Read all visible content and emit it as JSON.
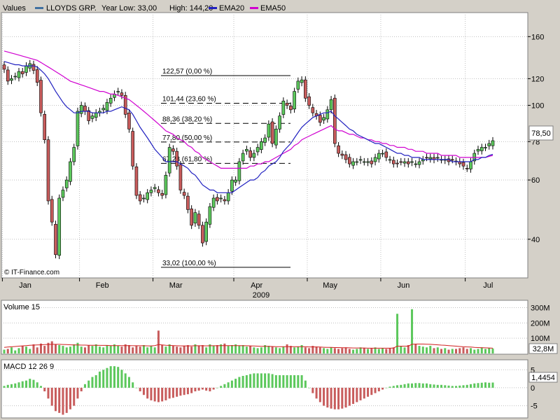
{
  "header": {
    "values_label": "Values",
    "symbol": "LLOYDS GRP.",
    "year_low_label": "Year Low: 33,00",
    "year_high_label": "High: 144,20",
    "ema20_label": "EMA20",
    "ema50_label": "EMA50"
  },
  "colors": {
    "background": "#d4d0c8",
    "plot_bg": "#ffffff",
    "grid": "#c0c0c0",
    "up": "#5cc85c",
    "down": "#c85c5c",
    "ema20": "#2020c0",
    "ema50": "#d000d0",
    "volume_ma": "#d02020",
    "symbol_swatch": "#4070a0"
  },
  "watermark": "© IT-Finance.com",
  "chart_data": [
    {
      "type": "candlestick",
      "title": "LLOYDS GRP.",
      "y_scale": "log",
      "ylim": [
        31,
        185
      ],
      "y_ticks": [
        "40",
        "60",
        "78",
        "100",
        "120",
        "160"
      ],
      "x_months": [
        "Jan",
        "Feb",
        "Mar",
        "Apr",
        "May",
        "Jun",
        "Jul"
      ],
      "x_year_label": "2009",
      "last_value_label": "78,50",
      "fib_levels": [
        {
          "label": "122,57 (0,00 %)",
          "value": 122.57
        },
        {
          "label": "101,44 (23,60 %)",
          "value": 101.44
        },
        {
          "label": "88,36 (38,20 %)",
          "value": 88.36
        },
        {
          "label": "77,80 (50,00 %)",
          "value": 77.8
        },
        {
          "label": "67,23 (61,80 %)",
          "value": 67.23
        },
        {
          "label": "33,02 (100,00 %)",
          "value": 33.02
        }
      ],
      "close": [
        128,
        118,
        120,
        122,
        126,
        124,
        131,
        133,
        127,
        117,
        95,
        79,
        52,
        45,
        36,
        53,
        56,
        60,
        68,
        75,
        96,
        100,
        96,
        90,
        93,
        95,
        96,
        98,
        102,
        105,
        108,
        110,
        107,
        94,
        85,
        66,
        54,
        52,
        53,
        55,
        56,
        57,
        55,
        54,
        62,
        75,
        73,
        66,
        56,
        54,
        49,
        44,
        48,
        44,
        39,
        45,
        50,
        53,
        52,
        53,
        52,
        55,
        60,
        60,
        68,
        72,
        74,
        70,
        72,
        75,
        78,
        80,
        88,
        77,
        85,
        93,
        103,
        100,
        97,
        110,
        118,
        119,
        105,
        100,
        95,
        93,
        89,
        92,
        97,
        104,
        77,
        72,
        71,
        69,
        67,
        68,
        68,
        69,
        68,
        68,
        67,
        70,
        72,
        72,
        70,
        69,
        67,
        67,
        68,
        68,
        67,
        68,
        67,
        68,
        69,
        70,
        70,
        69,
        70,
        69,
        69,
        68,
        69,
        68,
        67,
        66,
        65,
        68,
        72,
        74,
        75,
        75,
        77,
        78.5
      ],
      "series": [
        {
          "name": "EMA20",
          "values": [
            135,
            134,
            133,
            132,
            132,
            131,
            131,
            131,
            131,
            130,
            127,
            124,
            120,
            115,
            110,
            106,
            102,
            99,
            97,
            95,
            95,
            96,
            96,
            96,
            95,
            95,
            95,
            95,
            96,
            96,
            97,
            98,
            99,
            98,
            97,
            94,
            90,
            86,
            83,
            80,
            77,
            74,
            72,
            70,
            68,
            68,
            68,
            68,
            67,
            66,
            65,
            63,
            62,
            60,
            58,
            57,
            56,
            56,
            55,
            55,
            55,
            55,
            55,
            56,
            57,
            58,
            59,
            60,
            60,
            61,
            63,
            64,
            66,
            67,
            68,
            70,
            73,
            75,
            77,
            80,
            83,
            86,
            88,
            90,
            92,
            93,
            94,
            95,
            95,
            96,
            93,
            91,
            89,
            87,
            85,
            84,
            82,
            81,
            80,
            79,
            78,
            77,
            77,
            76,
            75,
            74,
            73,
            72,
            72,
            71,
            71,
            70,
            70,
            70,
            69,
            69,
            69,
            69,
            69,
            69,
            69,
            69,
            68,
            68,
            68,
            68,
            68,
            68,
            69,
            69,
            70,
            70,
            71,
            71.5
          ]
        },
        {
          "name": "EMA50",
          "values": [
            145,
            144,
            143,
            142,
            141,
            140,
            139,
            138,
            137,
            136,
            134,
            132,
            130,
            128,
            126,
            124,
            122,
            120,
            118,
            117,
            116,
            115,
            114,
            113,
            112,
            111,
            110,
            110,
            109,
            108,
            108,
            107,
            106,
            105,
            104,
            102,
            100,
            98,
            96,
            94,
            92,
            90,
            88,
            86,
            84,
            83,
            82,
            80,
            79,
            78,
            76,
            75,
            73,
            72,
            70,
            69,
            68,
            67,
            66,
            65,
            65,
            65,
            65,
            65,
            65,
            65,
            65,
            66,
            66,
            67,
            67,
            68,
            68,
            69,
            70,
            71,
            72,
            73,
            74,
            76,
            77,
            79,
            80,
            81,
            82,
            83,
            84,
            85,
            86,
            87,
            85,
            84,
            84,
            83,
            82,
            82,
            81,
            80,
            80,
            79,
            79,
            78,
            78,
            77,
            77,
            76,
            76,
            75,
            75,
            75,
            74,
            74,
            73,
            73,
            73,
            72,
            72,
            72,
            72,
            71,
            71,
            71,
            71,
            71,
            70,
            70,
            70,
            70,
            70,
            70,
            70,
            70,
            70.5,
            71
          ]
        }
      ]
    },
    {
      "type": "bar",
      "title": "Volume 15",
      "ylim": [
        0,
        330
      ],
      "y_ticks": [
        "100M",
        "200M",
        "300M"
      ],
      "last_value_label": "32,8M",
      "values": [
        25,
        30,
        40,
        20,
        35,
        50,
        45,
        30,
        60,
        40,
        65,
        50,
        70,
        80,
        60,
        55,
        50,
        40,
        45,
        60,
        70,
        45,
        40,
        55,
        50,
        60,
        45,
        40,
        55,
        50,
        60,
        50,
        45,
        60,
        55,
        40,
        50,
        45,
        55,
        40,
        48,
        40,
        150,
        55,
        45,
        60,
        50,
        45,
        40,
        50,
        55,
        45,
        60,
        50,
        55,
        40,
        60,
        50,
        55,
        60,
        65,
        50,
        55,
        60,
        50,
        55,
        45,
        50,
        40,
        35,
        40,
        55,
        50,
        45,
        40,
        35,
        45,
        60,
        50,
        40,
        45,
        55,
        40,
        35,
        50,
        45,
        40,
        35,
        30,
        40,
        35,
        30,
        35,
        40,
        30,
        25,
        30,
        40,
        35,
        30,
        35,
        40,
        30,
        35,
        30,
        35,
        40,
        260,
        50,
        40,
        55,
        290,
        60,
        50,
        45,
        40,
        50,
        35,
        40,
        30,
        35,
        25,
        30,
        30,
        35,
        40,
        30,
        35,
        25,
        30,
        40,
        30,
        35,
        33
      ],
      "series": [
        {
          "name": "",
          "values": [
            40,
            42,
            44,
            46,
            48,
            50,
            52,
            54,
            55,
            56,
            57,
            58,
            59,
            60,
            60,
            60,
            59,
            58,
            57,
            56,
            56,
            55,
            55,
            54,
            54,
            54,
            53,
            53,
            53,
            52,
            52,
            52,
            52,
            52,
            52,
            51,
            51,
            51,
            51,
            50,
            50,
            52,
            58,
            56,
            54,
            53,
            52,
            51,
            50,
            50,
            50,
            50,
            51,
            51,
            51,
            50,
            51,
            51,
            51,
            52,
            52,
            52,
            52,
            52,
            52,
            51,
            51,
            50,
            49,
            48,
            47,
            47,
            47,
            46,
            45,
            45,
            45,
            45,
            45,
            45,
            45,
            45,
            44,
            43,
            43,
            43,
            42,
            41,
            40,
            40,
            39,
            39,
            38,
            38,
            37,
            36,
            36,
            36,
            36,
            35,
            35,
            35,
            35,
            35,
            35,
            35,
            36,
            48,
            48,
            48,
            48,
            60,
            62,
            62,
            62,
            61,
            60,
            58,
            57,
            55,
            54,
            52,
            50,
            48,
            46,
            44,
            43,
            42,
            40,
            39,
            38,
            37,
            36,
            35
          ]
        }
      ]
    },
    {
      "type": "bar",
      "title": "MACD 12 26 9",
      "ylim": [
        -8,
        7
      ],
      "y_ticks": [
        "-5",
        "0",
        "5"
      ],
      "last_value_label": "1,4454",
      "values": [
        0.5,
        0.8,
        1,
        1.2,
        1.5,
        1.8,
        2,
        2.5,
        2.2,
        1.5,
        0.5,
        -1,
        -3,
        -5,
        -6.5,
        -7,
        -7.5,
        -7,
        -6,
        -5,
        -3,
        -1,
        1,
        2,
        3,
        3.5,
        4.5,
        5,
        5.5,
        6,
        6,
        5.8,
        5,
        4,
        3,
        1.5,
        0,
        -1,
        -2,
        -3,
        -3.5,
        -3.8,
        -4,
        -3.8,
        -3.5,
        -3,
        -2.8,
        -2.5,
        -2.2,
        -2,
        -1.8,
        -1.5,
        -1,
        -0.8,
        -0.5,
        -0.8,
        -1,
        -0.5,
        0,
        0.5,
        1,
        1.5,
        2,
        2.5,
        3,
        3.3,
        3.5,
        3.8,
        4,
        4,
        4,
        4,
        4,
        3.8,
        3.5,
        3.5,
        3.5,
        3.5,
        3.5,
        3.5,
        3.5,
        3.5,
        2,
        0,
        -1.5,
        -3,
        -4,
        -5,
        -5.5,
        -5.8,
        -6,
        -6,
        -5.8,
        -5.5,
        -5,
        -4.5,
        -4,
        -3.5,
        -3,
        -2.5,
        -2,
        -1.5,
        -1,
        -0.5,
        0,
        0.3,
        0.5,
        0.7,
        0.8,
        1,
        1.2,
        1.2,
        1.3,
        1.3,
        1.2,
        1.2,
        1,
        0.9,
        0.8,
        0.8,
        0.7,
        0.6,
        0.5,
        0.5,
        0.6,
        0.7,
        0.8,
        1,
        1.2,
        1.3,
        1.4,
        1.5,
        1.4,
        1.45
      ]
    }
  ]
}
